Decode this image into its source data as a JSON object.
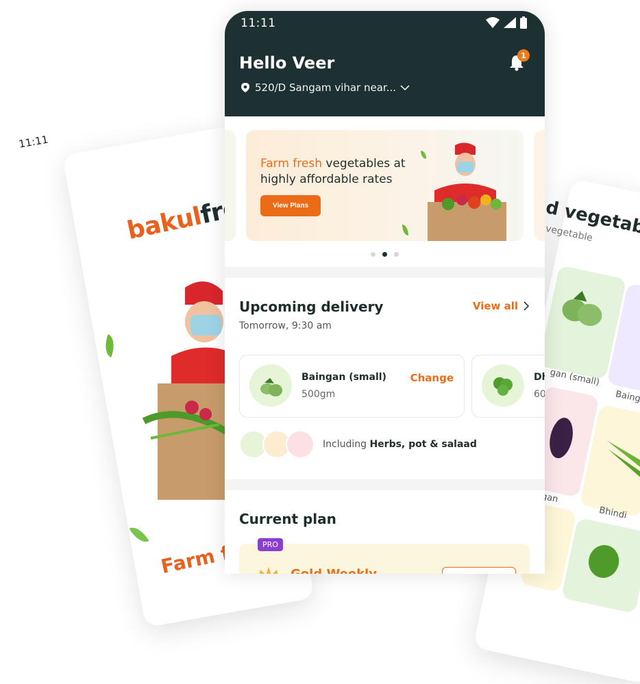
{
  "background": {
    "time": "11:11",
    "brand_a": "bakul",
    "brand_b": "fre",
    "bottom_text": "Farm fr",
    "veg_title": "d vegetable",
    "veg_sub": "vegetable",
    "veg_labels": [
      "gan (small)",
      "Baing",
      "gan",
      "Bhindi"
    ]
  },
  "status": {
    "time": "11:11"
  },
  "header": {
    "greeting": "Hello Veer",
    "location": "520/D Sangam vihar near...",
    "notification_count": "1"
  },
  "banner": {
    "highlight": "Farm fresh",
    "text": " vegetables at highly affordable rates",
    "button": "View Plans"
  },
  "upcoming": {
    "title": "Upcoming delivery",
    "subtitle": "Tomorrow, 9:30 am",
    "view_all": "View all",
    "items": [
      {
        "name": "Baingan (small)",
        "qty": "500gm",
        "action": "Change"
      },
      {
        "name": "Dh",
        "qty": "60"
      }
    ],
    "including_prefix": "Including ",
    "including_bold": "Herbs, pot & salaad"
  },
  "plan": {
    "title": "Current plan",
    "badge": "PRO",
    "name": "Gold Weekly"
  },
  "colors": {
    "header_bg": "#1d3132",
    "accent": "#ea6d1a",
    "pro_badge": "#8b3fd1"
  }
}
